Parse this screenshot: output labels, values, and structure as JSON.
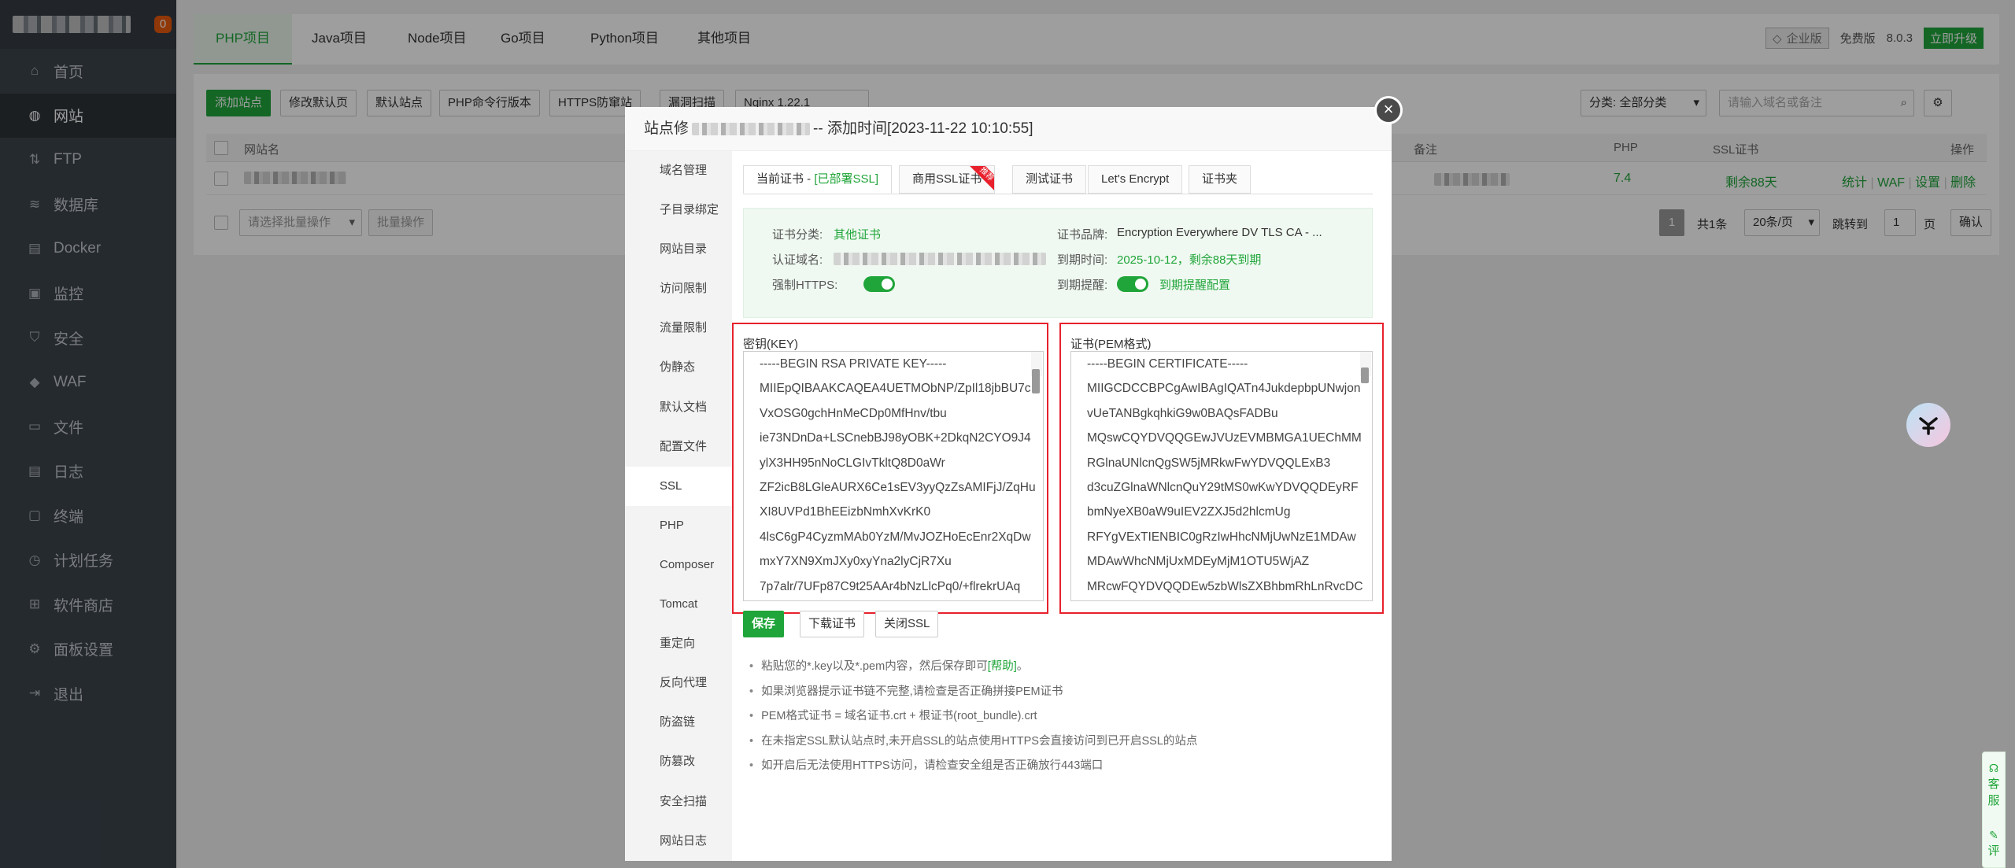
{
  "sidebar": {
    "badge": "0",
    "items": [
      {
        "label": "首页",
        "icon": "home-icon"
      },
      {
        "label": "网站",
        "icon": "globe-icon"
      },
      {
        "label": "FTP",
        "icon": "ftp-icon"
      },
      {
        "label": "数据库",
        "icon": "database-icon"
      },
      {
        "label": "Docker",
        "icon": "docker-icon"
      },
      {
        "label": "监控",
        "icon": "monitor-icon"
      },
      {
        "label": "安全",
        "icon": "shield-icon"
      },
      {
        "label": "WAF",
        "icon": "waf-shield-icon"
      },
      {
        "label": "文件",
        "icon": "folder-icon"
      },
      {
        "label": "日志",
        "icon": "log-icon"
      },
      {
        "label": "终端",
        "icon": "terminal-icon"
      },
      {
        "label": "计划任务",
        "icon": "clock-icon"
      },
      {
        "label": "软件商店",
        "icon": "apps-icon"
      },
      {
        "label": "面板设置",
        "icon": "gear-icon"
      },
      {
        "label": "退出",
        "icon": "logout-icon"
      }
    ]
  },
  "tabs": [
    "PHP项目",
    "Java项目",
    "Node项目",
    "Go项目",
    "Python项目",
    "其他项目"
  ],
  "header_right": {
    "edition": "企业版",
    "free": "免费版",
    "version": "8.0.3",
    "upgrade": "立即升级"
  },
  "toolbar": {
    "add_site": "添加站点",
    "modify_default_page": "修改默认页",
    "default_site": "默认站点",
    "php_cli": "PHP命令行版本",
    "https_protect": "HTTPS防窜站",
    "vuln_scan": "漏洞扫描",
    "nginx": "Nginx 1.22.1",
    "category": "分类: 全部分类",
    "search_placeholder": "请输入域名或备注"
  },
  "table": {
    "col_site": "网站名",
    "col_note": "备注",
    "col_php": "PHP",
    "col_ssl": "SSL证书",
    "col_ops": "操作",
    "row": {
      "php": "7.4",
      "ssl": "剩余88天",
      "ops": [
        "统计",
        "WAF",
        "设置",
        "删除"
      ]
    },
    "batch_placeholder": "请选择批量操作",
    "batch_button": "批量操作",
    "pager": {
      "page": "1",
      "total": "共1条",
      "per_page": "20条/页",
      "goto": "跳转到",
      "goto_value": "1",
      "page_unit": "页",
      "confirm": "确认"
    }
  },
  "modal": {
    "title_prefix": "站点修",
    "title_suffix": "-- 添加时间[2023-11-22 10:10:55]",
    "close": "×",
    "menu": [
      "域名管理",
      "子目录绑定",
      "网站目录",
      "访问限制",
      "流量限制",
      "伪静态",
      "默认文档",
      "配置文件",
      "SSL",
      "PHP",
      "Composer",
      "Tomcat",
      "重定向",
      "反向代理",
      "防盗链",
      "防篡改",
      "安全扫描",
      "网站日志"
    ],
    "ssl_tabs": [
      {
        "label": "当前证书 - ",
        "extra": "[已部署SSL]"
      },
      {
        "label": "商用SSL证书",
        "ribbon": "推荐"
      },
      {
        "label": "测试证书"
      },
      {
        "label": "Let's Encrypt"
      },
      {
        "label": "证书夹"
      }
    ],
    "info": {
      "cert_type_label": "证书分类:",
      "cert_type_value": "其他证书",
      "brand_label": "证书品牌:",
      "brand_value": "Encryption Everywhere DV TLS CA - ...",
      "domain_label": "认证域名:",
      "expire_label": "到期时间:",
      "expire_value": "2025-10-12，剩余88天到期",
      "force_https_label": "强制HTTPS:",
      "remind_label": "到期提醒:",
      "remind_link": "到期提醒配置"
    },
    "key_label": "密钥(KEY)",
    "cert_label": "证书(PEM格式)",
    "key_lines": [
      "-----BEGIN RSA PRIVATE KEY-----",
      "MIIEpQIBAAKCAQEA4UETMObNP/ZpIl18jbBU7c",
      "VxOSG0gchHnMeCDp0MfHnv/tbu",
      "ie73NDnDa+LSCnebBJ98yOBK+2DkqN2CYO9J4",
      "ylX3HH95nNoCLGIvTkltQ8D0aWr",
      "ZF2icB8LGleAURX6Ce1sEV3yyQzZsAMIFjJ/ZqHu",
      "XI8UVPd1BhEEizbNmhXvKrK0",
      "4lsC6gP4CyzmMAb0YzM/MvJOZHoEcEnr2XqDw",
      "mxY7XN9XmJXy0xyYna2lyCjR7Xu",
      "7p7alr/7UFp87C9t25AAr4bNzLlcPq0/+flrekrUAq"
    ],
    "cert_lines": [
      "-----BEGIN CERTIFICATE-----",
      "MIIGCDCCBPCgAwIBAgIQATn4JukdepbpUNwjon",
      "vUeTANBgkqhkiG9w0BAQsFADBu",
      "MQswCQYDVQQGEwJVUzEVMBMGA1UEChMM",
      "RGlnaUNlcnQgSW5jMRkwFwYDVQQLExB3",
      "d3cuZGlnaWNlcnQuY29tMS0wKwYDVQQDEyRF",
      "bmNyeXB0aW9uIEV2ZXJ5d2hlcmUg",
      "RFYgVExTIENBIC0gRzIwHhcNMjUwNzE1MDAw",
      "MDAwWhcNMjUxMDEyMjM1OTU5WjAZ",
      "MRcwFQYDVQQDEw5zbWlsZXBhbmRhLnRvcDC"
    ],
    "buttons": {
      "save": "保存",
      "download": "下载证书",
      "close_ssl": "关闭SSL"
    },
    "tips": [
      {
        "text": "粘贴您的*.key以及*.pem内容，然后保存即可",
        "link": "[帮助]",
        "end": "。"
      },
      {
        "text": "如果浏览器提示证书链不完整,请检查是否正确拼接PEM证书"
      },
      {
        "text": "PEM格式证书 = 域名证书.crt + 根证书(root_bundle).crt"
      },
      {
        "text": "在未指定SSL默认站点时,未开启SSL的站点使用HTTPS会直接访问到已开启SSL的站点"
      },
      {
        "text": "如开启后无法使用HTTPS访问，请检查安全组是否正确放行443端口"
      }
    ]
  },
  "service": {
    "label1": "客",
    "label2": "服",
    "label3": "评"
  },
  "colors": {
    "accent": "#20a53a",
    "sidebar": "#3c444d",
    "highlight": "#e8212c"
  }
}
